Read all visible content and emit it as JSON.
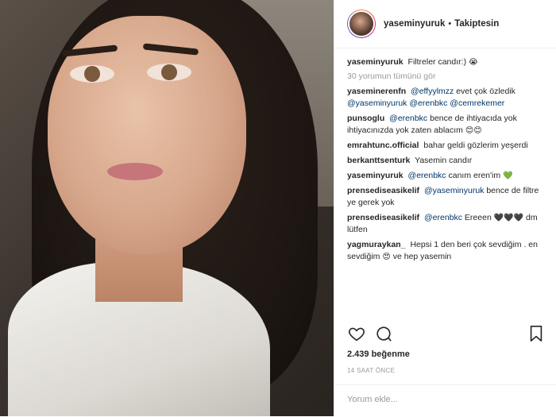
{
  "post": {
    "author": "yaseminyuruk",
    "follow_status": "Takiptesin",
    "dot": "•"
  },
  "caption": {
    "user": "yaseminyuruk",
    "text": "Filtreler candır:)",
    "emoji": "😭"
  },
  "view_all_comments": "30 yorumun tümünü gör",
  "comments": [
    {
      "user": "yaseminerenfn",
      "mention": "@effyylmzz",
      "text": "evet çok özledik",
      "mention2": "@yaseminyuruk",
      "mention3": "@erenbkc",
      "mention4": "@cemrekemer"
    },
    {
      "user": "punsoglu",
      "mention": "@erenbkc",
      "text": "bence de ihtiyacıda yok ihtiyacınızda yok zaten ablacım",
      "emoji": "😊😊"
    },
    {
      "user": "emrahtunc.official",
      "text": "bahar geldi gözlerim yeşerdi"
    },
    {
      "user": "berkanttsenturk",
      "text": "Yasemin candır"
    },
    {
      "user": "yaseminyuruk",
      "mention": "@erenbkc",
      "text": "canım eren'im",
      "emoji": "💚"
    },
    {
      "user": "prensediseasikelif",
      "mention": "@yaseminyuruk",
      "text": "bence de filtre ye gerek yok"
    },
    {
      "user": "prensediseasikelif",
      "mention": "@erenbkc",
      "text": "Ereeen",
      "emoji": "🖤🖤🖤",
      "text2": "dm lütfen"
    },
    {
      "user": "yagmuraykan_",
      "text": "Hepsi 1 den beri çok sevdiğim . en sevdiğim",
      "emoji": "😍",
      "text2": "ve hep yasemin"
    }
  ],
  "actions": {
    "like_icon": "heart-icon",
    "comment_icon": "comment-icon",
    "save_icon": "bookmark-icon"
  },
  "likes": "2.439 beğenme",
  "timestamp": "14 SAAT ÖNCE",
  "comment_input": {
    "placeholder": "Yorum ekle..."
  }
}
